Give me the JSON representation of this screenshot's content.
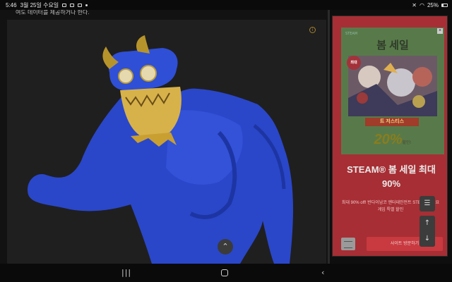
{
  "status_bar": {
    "time": "5:46",
    "date": "3월 25일 수요일",
    "battery": "25%",
    "battery_level": 0.25
  },
  "article": {
    "partial_text": "여도 데이터를 제공하거나 한다.",
    "figure_alt_name": "blue-monster-figure"
  },
  "ad": {
    "brand_small": "STEAM",
    "sale_title": "봄 세일",
    "badge_text": "최대",
    "game_title": "트 저스티스",
    "discount": "20%",
    "discount_suffix": "할인!",
    "headline": "STEAM® 봄 세일 최대 90%",
    "description": "최대 90% off! 반다이남코 엔터테인먼트 STEAM® 주요 게임 특별 할인",
    "cta": "사이트 방문하기",
    "close_icon": "close-icon",
    "colors": {
      "card_bg": "#a72e34",
      "image_bg": "#587a4a",
      "cta_bg": "#c83a40"
    }
  },
  "floating": {
    "list_icon": "☰",
    "up_icon": "↑",
    "down_icon": "↓"
  },
  "scroll_top_icon": "⌃",
  "nav": {
    "recent": "|||",
    "back": "‹"
  }
}
